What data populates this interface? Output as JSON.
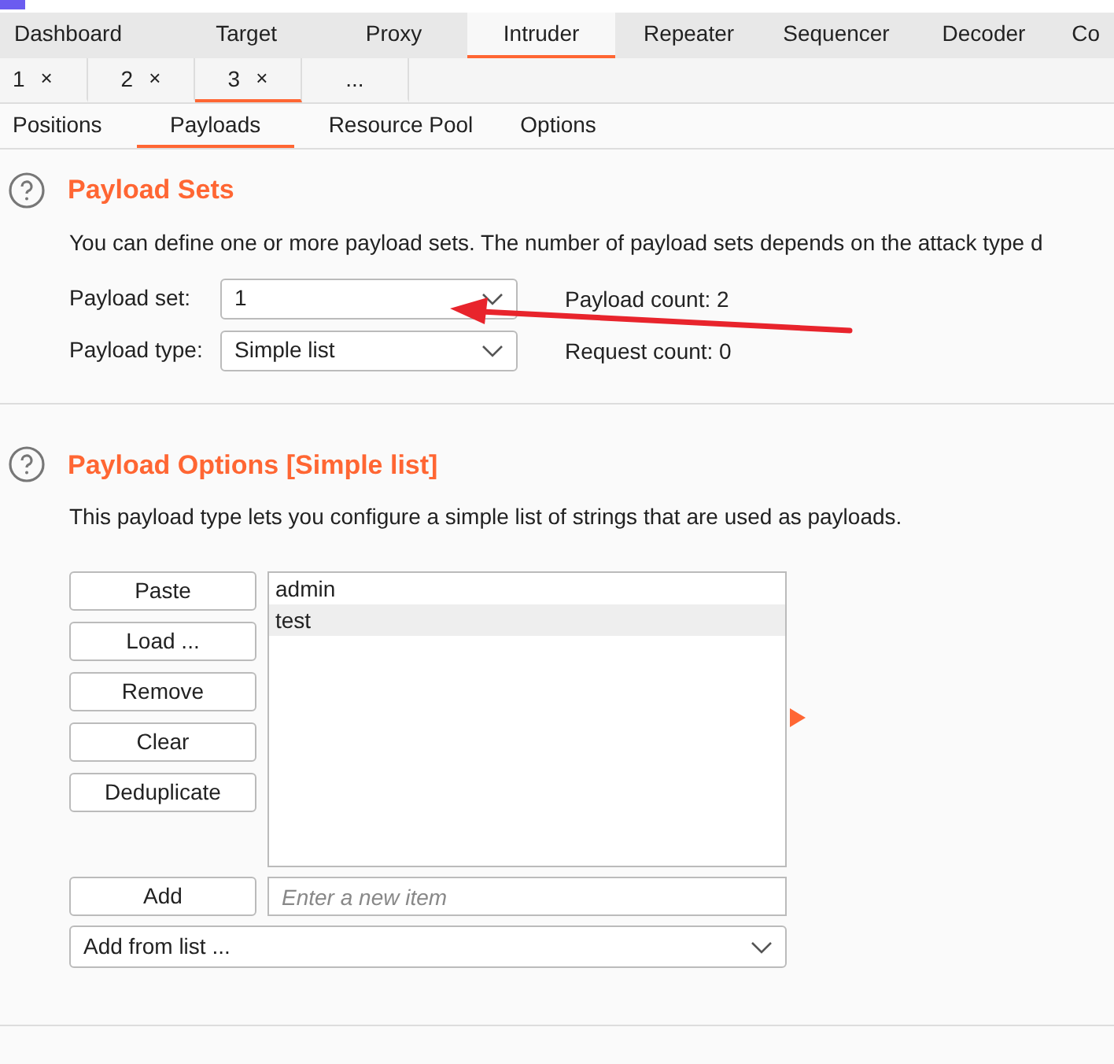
{
  "main_tabs": [
    {
      "label": "Dashboard",
      "selected": false
    },
    {
      "label": "Target",
      "selected": false
    },
    {
      "label": "Proxy",
      "selected": false
    },
    {
      "label": "Intruder",
      "selected": true
    },
    {
      "label": "Repeater",
      "selected": false
    },
    {
      "label": "Sequencer",
      "selected": false
    },
    {
      "label": "Decoder",
      "selected": false
    },
    {
      "label": "Co",
      "selected": false
    }
  ],
  "attack_tabs": [
    {
      "label": "1",
      "close": "×",
      "selected": false
    },
    {
      "label": "2",
      "close": "×",
      "selected": false
    },
    {
      "label": "3",
      "close": "×",
      "selected": true
    },
    {
      "label": "...",
      "selected": false
    }
  ],
  "sub_tabs": [
    {
      "label": "Positions",
      "selected": false
    },
    {
      "label": "Payloads",
      "selected": true
    },
    {
      "label": "Resource Pool",
      "selected": false
    },
    {
      "label": "Options",
      "selected": false
    }
  ],
  "payload_sets": {
    "title": "Payload Sets",
    "description": "You can define one or more payload sets. The number of payload sets depends on the attack type d",
    "set_label": "Payload set:",
    "set_value": "1",
    "type_label": "Payload type:",
    "type_value": "Simple list",
    "payload_count": "Payload count: 2",
    "request_count": "Request count: 0"
  },
  "payload_options": {
    "title": "Payload Options [Simple list]",
    "description": "This payload type lets you configure a simple list of strings that are used as payloads.",
    "buttons": [
      "Paste",
      "Load ...",
      "Remove",
      "Clear",
      "Deduplicate"
    ],
    "items": [
      {
        "text": "admin",
        "selected": false
      },
      {
        "text": "test",
        "selected": true
      }
    ],
    "add_button": "Add",
    "add_placeholder": "Enter a new item",
    "add_from_list": "Add from list ..."
  }
}
